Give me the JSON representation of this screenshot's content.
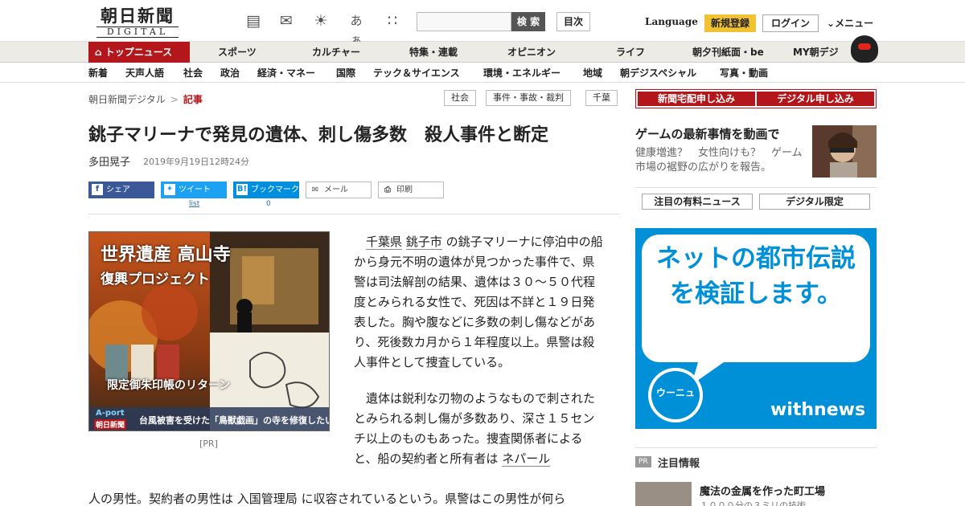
{
  "header": {
    "logo_jp": "朝日新聞",
    "logo_en": "DIGITAL",
    "search_button": "検 索",
    "index_button": "目次",
    "language": "Language",
    "register": "新規登録",
    "login": "ログイン",
    "menu": "メニュー",
    "font_toggle": "あぁ"
  },
  "nav_main": [
    "トップニュース",
    "スポーツ",
    "カルチャー",
    "特集・連載",
    "オピニオン",
    "ライフ",
    "朝夕刊紙面・be",
    "MY朝デジ"
  ],
  "nav_sub": [
    "新着",
    "天声人語",
    "社会",
    "政治",
    "経済・マネー",
    "国際",
    "テック＆サイエンス",
    "環境・エネルギー",
    "地域",
    "朝デジスペシャル",
    "写真・動画"
  ],
  "breadcrumb": {
    "home": "朝日新聞デジタル",
    "sep": ">",
    "current": "記事"
  },
  "tags": [
    "社会",
    "事件・事故・裁判",
    "千葉"
  ],
  "article": {
    "title": "銚子マリーナで発見の遺体、刺し傷多数　殺人事件と断定",
    "author": "多田晃子",
    "date": "2019年9月19日12時24分",
    "share": {
      "facebook": "シェア",
      "twitter": "ツイート",
      "hatena": "ブックマーク",
      "mail": "メール",
      "print": "印刷",
      "twitter_count": "list",
      "hatena_count": "0"
    },
    "ad_caption": "[PR]",
    "ad": {
      "line1": "世界遺産 高山寺",
      "line2": "復興プロジェクト",
      "line3": "限定御朱印帳のリターン",
      "brand": "A-port",
      "brand_sub": "朝日新聞",
      "tagline": "台風被害を受けた「鳥獣戯画」の寺を修復したい"
    },
    "p1_link1": "千葉県",
    "p1_link2": "銚子市",
    "p1_text": "の銚子マリーナに停泊中の船から身元不明の遺体が見つかった事件で、県警は司法解剖の結果、遺体は３０～５０代程度とみられる女性で、死因は不詳と１９日発表した。胸や腹などに多数の刺し傷などがあり、死後数カ月から１年程度以上。県警は殺人事件として捜査している。",
    "p2_text": "遺体は鋭利な刃物のようなもので刺されたとみられる刺し傷が多数あり、深さ１５センチ以上のものもあった。捜査関係者によると、船の契約者と所有者は",
    "p2_link": "ネパール",
    "p3_a": "人の男性。契約者の男性は",
    "p3_link": "入国管理局",
    "p3_b": "に収容されているという。県警はこの男性が何ら"
  },
  "sidebar": {
    "subscribe_paper": "新聞宅配申し込み",
    "subscribe_digital": "デジタル申し込み",
    "promo_title": "ゲームの最新事情を動画で",
    "promo_text": "健康増進？　女性向けも？　ゲーム市場の裾野の広がりを報告。",
    "tab1": "注目の有料ニュース",
    "tab2": "デジタル限定",
    "banner_text": "ネットの都市伝説を検証します。",
    "banner_brand": "withnews",
    "banner_mascot": "ウーニュ",
    "pr_badge": "PR",
    "pr_title": "注目情報",
    "pr_item": "魔法の金属を作った町工場",
    "pr_sub": "１０００分の３ミリの技術"
  },
  "colors": {
    "brand_red": "#b3171b",
    "register_yellow": "#f1c232",
    "facebook": "#3b5998",
    "twitter": "#1da1f2",
    "hatena": "#008fde",
    "banner_blue": "#0090d8"
  }
}
